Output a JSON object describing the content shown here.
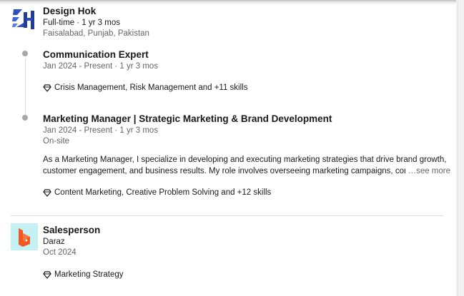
{
  "experience": {
    "design_hok": {
      "company": "Design Hok",
      "employment": "Full-time · 1 yr 3 mos",
      "location": "Faisalabad, Punjab, Pakistan",
      "roles": [
        {
          "title": "Communication Expert",
          "dates": "Jan 2024 - Present · 1 yr 3 mos",
          "skills": "Crisis Management, Risk Management and +11 skills"
        },
        {
          "title": "Marketing Manager | Strategic Marketing & Brand Development",
          "dates": "Jan 2024 - Present · 1 yr 3 mos",
          "workplace": "On-site",
          "description_line1": "As a Marketing Manager, I specialize in developing and executing marketing strategies that drive brand growth,",
          "description_line2": "customer engagement, and business results. My role involves overseeing marketing campaigns, condi",
          "see_more": "…see more",
          "skills": "Content Marketing, Creative Problem Solving and +12 skills"
        }
      ]
    },
    "daraz": {
      "title": "Salesperson",
      "company": "Daraz",
      "dates": "Oct 2024",
      "skills": "Marketing Strategy"
    }
  },
  "icons": {
    "company_logo_1": "design-hok-logo",
    "company_logo_2": "daraz-logo",
    "skill": "diamond-icon"
  },
  "colors": {
    "logo1_blue": "#2f4fbf",
    "logo2_bg": "#c4f1f3",
    "logo2_orange": "#f05a22",
    "muted_text": "#666666"
  }
}
